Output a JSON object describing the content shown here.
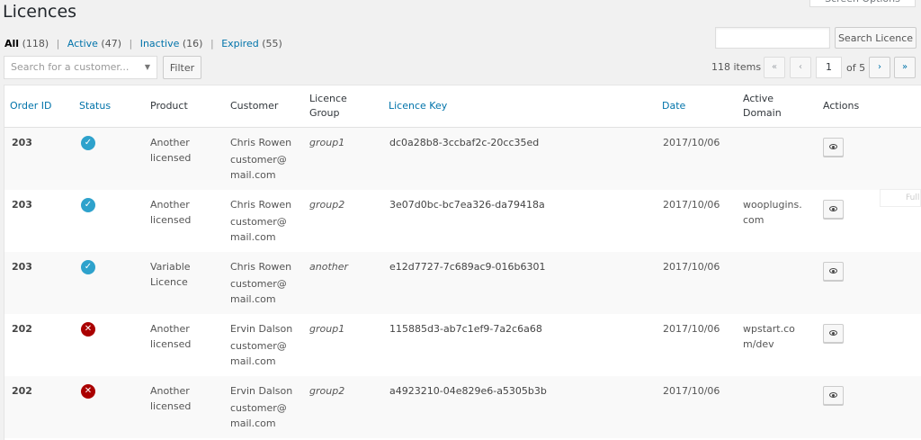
{
  "header": {
    "screen_options": "Screen Options",
    "title": "Licences"
  },
  "filters": [
    {
      "label": "All",
      "count": "(118)"
    },
    {
      "label": "Active",
      "count": "(47)"
    },
    {
      "label": "Inactive",
      "count": "(16)"
    },
    {
      "label": "Expired",
      "count": "(55)"
    }
  ],
  "search": {
    "button": "Search Licence",
    "value": ""
  },
  "customer_filter": {
    "placeholder": "Search for a customer...",
    "button": "Filter"
  },
  "pagination": {
    "items": "118 items",
    "current": "1",
    "of": "of 5",
    "first": "«",
    "prev": "‹",
    "next": "›",
    "last": "»"
  },
  "columns": [
    "Order ID",
    "Status",
    "Product",
    "Customer",
    "Licence Group",
    "Licence Key",
    "Date",
    "Active Domain",
    "Actions"
  ],
  "rows": [
    {
      "order": "203",
      "status": "active",
      "product": "Another licensed",
      "customer": "Chris Rowen",
      "email": "customer@mail.com",
      "group": "group1",
      "key": "dc0a28b8-3ccbaf2c-20cc35ed",
      "date": "2017/10/06",
      "domain": ""
    },
    {
      "order": "203",
      "status": "active",
      "product": "Another licensed",
      "customer": "Chris Rowen",
      "email": "customer@mail.com",
      "group": "group2",
      "key": "3e07d0bc-bc7ea326-da79418a",
      "date": "2017/10/06",
      "domain": "wooplugins.com"
    },
    {
      "order": "203",
      "status": "active",
      "product": "Variable Licence",
      "customer": "Chris Rowen",
      "email": "customer@mail.com",
      "group": "another",
      "key": "e12d7727-7c689ac9-016b6301",
      "date": "2017/10/06",
      "domain": ""
    },
    {
      "order": "202",
      "status": "expired",
      "product": "Another licensed",
      "customer": "Ervin Dalson",
      "email": "customer@mail.com",
      "group": "group1",
      "key": "115885d3-ab7c1ef9-7a2c6a68",
      "date": "2017/10/06",
      "domain": "wpstart.com/dev"
    },
    {
      "order": "202",
      "status": "expired",
      "product": "Another licensed",
      "customer": "Ervin Dalson",
      "email": "customer@mail.com",
      "group": "group2",
      "key": "a4923210-04e829e6-a5305b3b",
      "date": "2017/10/06",
      "domain": ""
    }
  ],
  "ghost_text": "Full",
  "icons": {
    "active": "check-circle-icon",
    "expired": "x-circle-icon",
    "view": "eye-icon"
  },
  "colors": {
    "link": "#0073aa",
    "active": "#2ea2cc",
    "expired": "#aa0000"
  }
}
